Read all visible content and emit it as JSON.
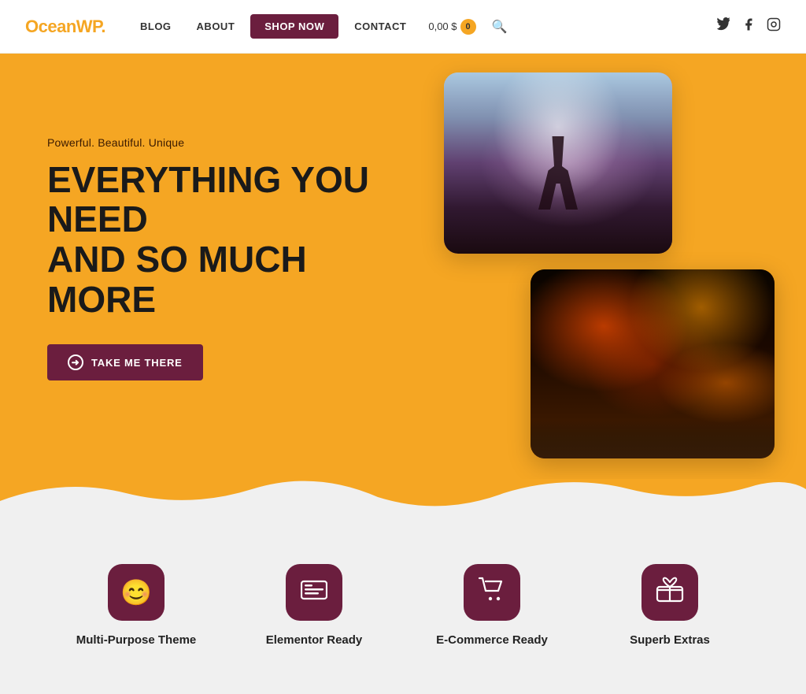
{
  "header": {
    "logo_text": "OceanWP",
    "logo_dot": ".",
    "nav": {
      "blog": "BLOG",
      "about": "ABOUT",
      "shop_now": "SHOP NOW",
      "contact": "CONTACT",
      "cart_price": "0,00 $",
      "cart_count": "0"
    },
    "social": {
      "twitter": "𝕏",
      "facebook": "f",
      "instagram": "📷"
    }
  },
  "hero": {
    "subtitle": "Powerful. Beautiful. Unique",
    "title_line1": "EVERYTHING YOU NEED",
    "title_line2": "AND SO MUCH MORE",
    "cta_label": "TAKE ME THERE"
  },
  "features": [
    {
      "id": "multipurpose",
      "icon": "😊",
      "label": "Multi-Purpose Theme"
    },
    {
      "id": "elementor",
      "icon": "🪪",
      "label": "Elementor Ready"
    },
    {
      "id": "ecommerce",
      "icon": "🛒",
      "label": "E-Commerce Ready"
    },
    {
      "id": "extras",
      "icon": "🎁",
      "label": "Superb Extras"
    }
  ],
  "colors": {
    "accent": "#f5a623",
    "dark_purple": "#6b1e3e",
    "bg_features": "#f0f0f0"
  }
}
